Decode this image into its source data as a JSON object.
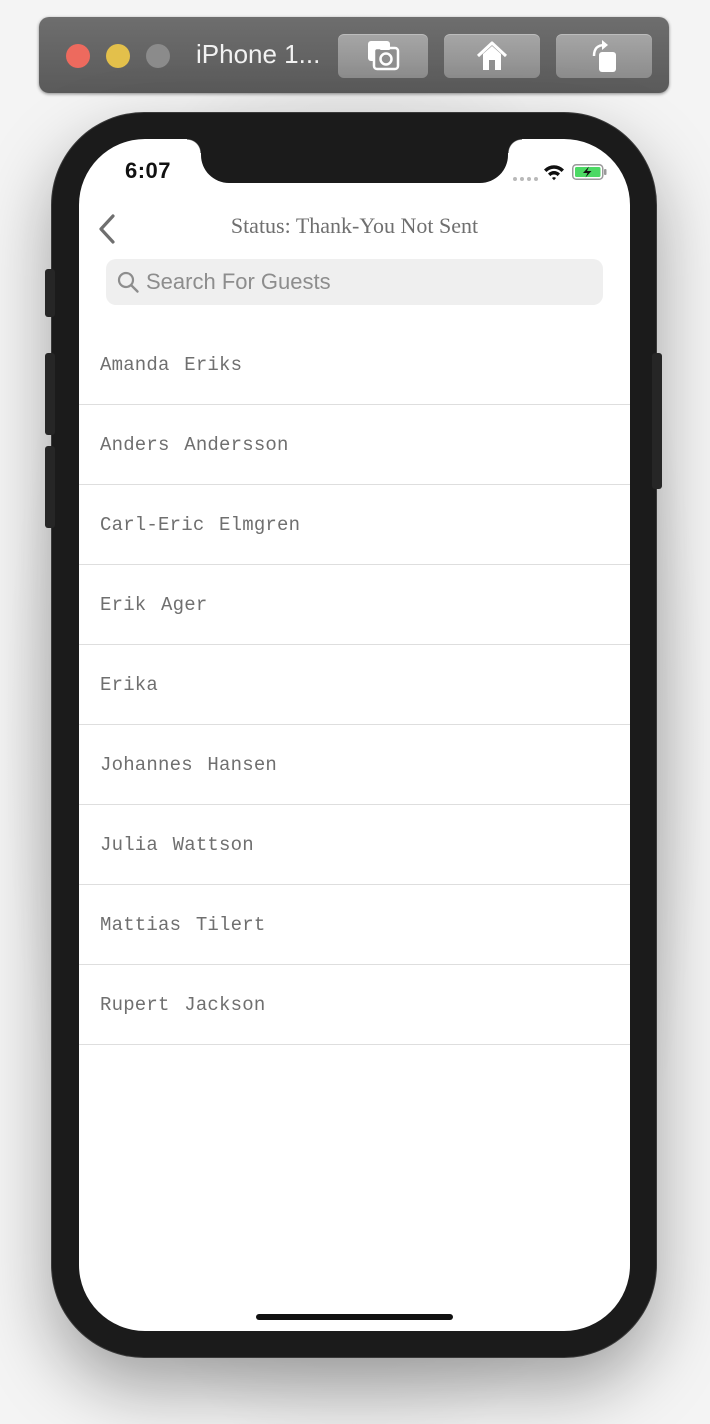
{
  "simulator": {
    "title": "iPhone 1...",
    "buttons": {
      "screenshot": "camera-icon",
      "home": "home-icon",
      "rotate": "rotate-icon"
    }
  },
  "status_bar": {
    "time": "6:07",
    "icons": [
      "signal-dots",
      "wifi-icon",
      "battery-charging-icon"
    ],
    "battery_color": "#4cd964"
  },
  "nav": {
    "back_icon": "chevron-left-icon",
    "title": "Status: Thank-You Not Sent"
  },
  "search": {
    "placeholder": "Search For Guests",
    "value": ""
  },
  "guests": [
    {
      "name": "Amanda Eriks"
    },
    {
      "name": "Anders Andersson"
    },
    {
      "name": "Carl-Eric Elmgren"
    },
    {
      "name": "Erik Ager"
    },
    {
      "name": "Erika"
    },
    {
      "name": "Johannes Hansen"
    },
    {
      "name": "Julia Wattson"
    },
    {
      "name": "Mattias Tilert"
    },
    {
      "name": "Rupert Jackson"
    }
  ],
  "colors": {
    "text_gray": "#6f6f6f",
    "separator": "#dedede",
    "search_bg": "#efefef"
  }
}
